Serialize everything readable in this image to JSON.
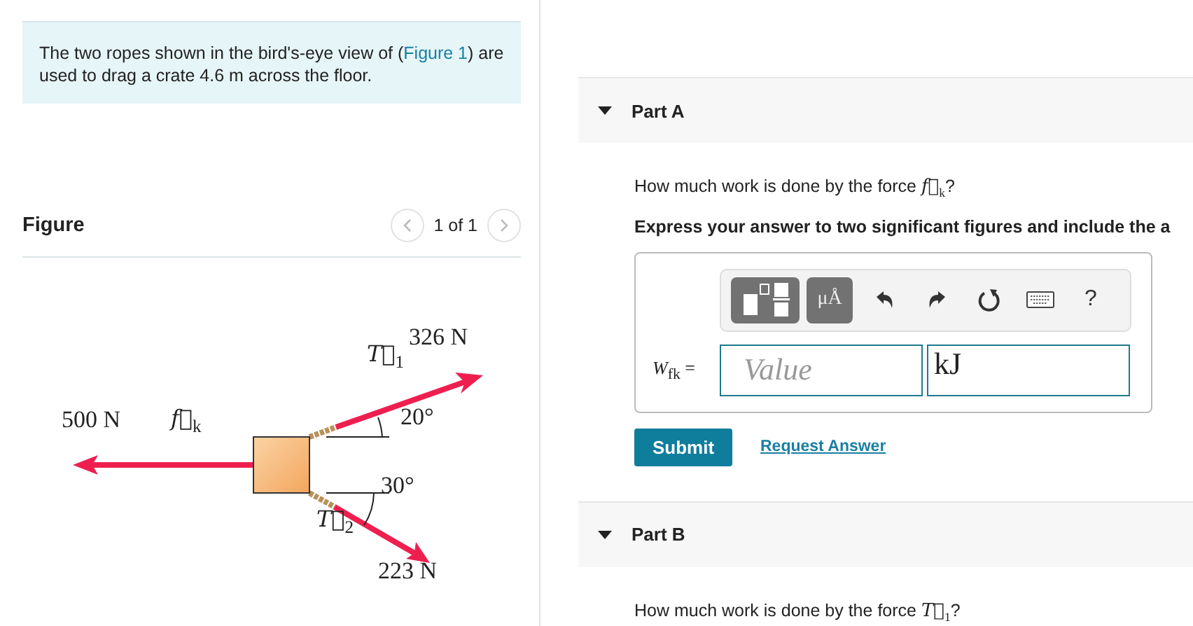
{
  "problem": {
    "text_before": "The two ropes shown in the bird's-eye view of (",
    "link": "Figure 1",
    "text_after": ") are used to drag a crate 4.6  m across the floor."
  },
  "figure": {
    "heading": "Figure",
    "pager": "1 of 1",
    "labels": [
      {
        "kind": "magnitude",
        "text": "326 N"
      },
      {
        "kind": "vector",
        "text": "*T⃗*$_{1}$"
      },
      {
        "kind": "magnitude",
        "text": "500 N"
      },
      {
        "kind": "vector",
        "text": "*f⃗*$_{k}$"
      },
      {
        "kind": "angle",
        "text": "20°"
      },
      {
        "kind": "angle",
        "text": "30°"
      },
      {
        "kind": "vector",
        "text": "*T⃗*$_{2}$"
      },
      {
        "kind": "magnitude",
        "text": "223 N"
      }
    ]
  },
  "parts": [
    {
      "title": "Part A",
      "expanded": true,
      "question": "How much work is done by the force *f⃗*$_{k}$?",
      "instructions": "Express your answer to two significant figures and include the a",
      "answer": {
        "toolbar": [
          {
            "kind": "templates"
          },
          {
            "kind": "units",
            "label": "μÅ"
          },
          {
            "kind": "undo"
          },
          {
            "kind": "redo"
          },
          {
            "kind": "reset"
          },
          {
            "kind": "keyboard"
          },
          {
            "kind": "help",
            "label": "?"
          }
        ],
        "variable": "*W*$_{fk}$ =",
        "placeholder": "Value",
        "unit": "kJ",
        "submit": "Submit",
        "request": "Request Answer"
      }
    },
    {
      "title": "Part B",
      "expanded": true,
      "question": "How much work is done by the force *T⃗*$_{1}$?"
    }
  ]
}
